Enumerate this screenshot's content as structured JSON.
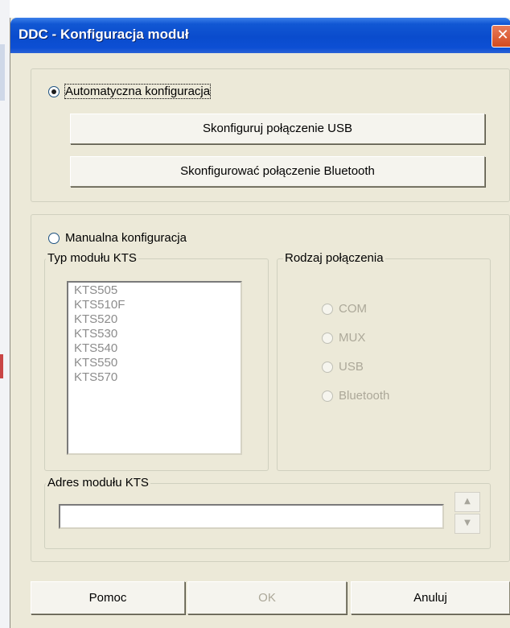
{
  "window": {
    "title": "DDC - Konfiguracja moduł",
    "close_glyph": "✕"
  },
  "auto": {
    "radio_label": "Automatyczna konfiguracja",
    "selected": true,
    "usb_button": "Skonfiguruj połączenie USB",
    "bt_button": "Skonfigurować połączenie Bluetooth"
  },
  "manual": {
    "radio_label": "Manualna konfiguracja",
    "selected": false,
    "module_type": {
      "label": "Typ modułu KTS",
      "items": [
        "KTS505",
        "KTS510F",
        "KTS520",
        "KTS530",
        "KTS540",
        "KTS550",
        "KTS570"
      ]
    },
    "connection": {
      "label": "Rodzaj połączenia",
      "options": [
        "COM",
        "MUX",
        "USB",
        "Bluetooth"
      ]
    },
    "address": {
      "label": "Adres modułu KTS",
      "value": "",
      "spin_up": "▲",
      "spin_down": "▼"
    }
  },
  "footer": {
    "help": "Pomoc",
    "ok": "OK",
    "cancel": "Anuluj"
  },
  "colors": {
    "window_bg": "#ece9d8",
    "titlebar": "#0a4ccd",
    "disabled_text": "#aca899"
  }
}
